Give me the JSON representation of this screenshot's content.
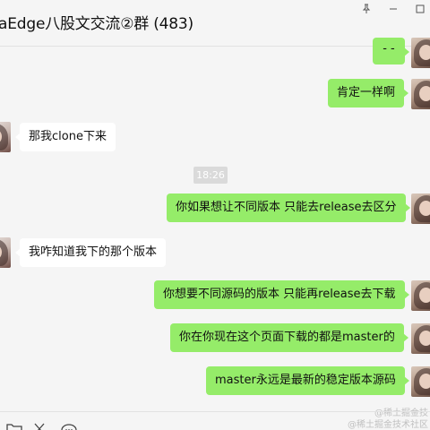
{
  "header": {
    "title": "aEdge八股文交流②群 (483)",
    "pin_icon": "pin-icon",
    "minimize_icon": "minimize-icon",
    "maximize_icon": "maximize-icon"
  },
  "messages": [
    {
      "side": "me",
      "text": "- -"
    },
    {
      "side": "me",
      "text": "肯定一样啊"
    },
    {
      "side": "other",
      "text": "那我clone下来"
    },
    {
      "side": "me",
      "text": "你如果想让不同版本 只能去release去区分"
    },
    {
      "side": "other",
      "text": "我咋知道我下的那个版本"
    },
    {
      "side": "me",
      "text": "你想要不同源码的版本 只能再release去下载"
    },
    {
      "side": "me",
      "text": "你在你现在这个页面下载的都是master的"
    },
    {
      "side": "me",
      "text": "master永远是最新的稳定版本源码"
    }
  ],
  "timestamp": "18:26",
  "toolbar": {
    "icons": [
      "folder-icon",
      "scissors-icon",
      "chat-history-icon"
    ]
  },
  "watermarks": [
    "@稀土掘金技",
    "@稀土掘金技术社区"
  ],
  "colors": {
    "my_bubble": "#95ec69",
    "other_bubble": "#ffffff",
    "background": "#f5f5f5"
  }
}
